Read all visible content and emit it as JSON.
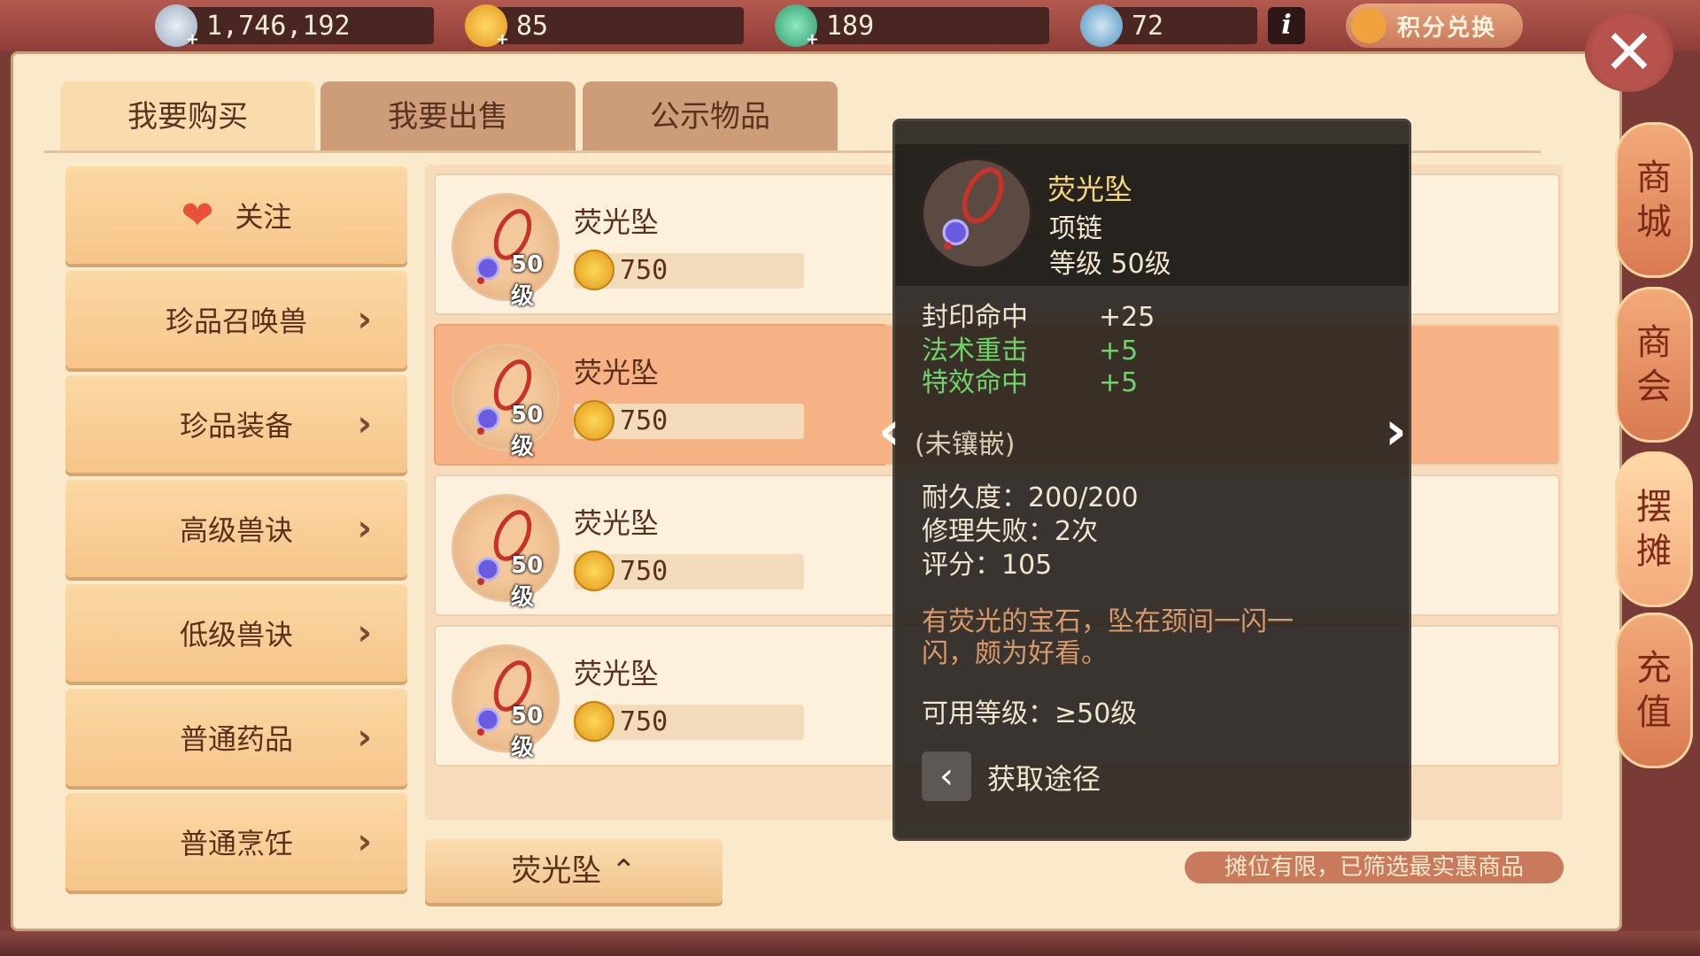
{
  "currencies": [
    {
      "name": "silver",
      "value": "1,746,192",
      "color": "#b7c7d9"
    },
    {
      "name": "dream-coin",
      "value": "85",
      "color": "#f0b53a"
    },
    {
      "name": "jade",
      "value": "189",
      "color": "#3fb98a"
    },
    {
      "name": "fortune",
      "value": "72",
      "color": "#5aa2c8"
    }
  ],
  "header": {
    "info": "i",
    "points_exchange": "积分兑换",
    "close": "✕"
  },
  "tabs": [
    {
      "label": "我要购买"
    },
    {
      "label": "我要出售"
    },
    {
      "label": "公示物品"
    }
  ],
  "categories": [
    {
      "label": "关注"
    },
    {
      "label": "珍品召唤兽"
    },
    {
      "label": "珍品装备"
    },
    {
      "label": "高级兽诀"
    },
    {
      "label": "低级兽诀"
    },
    {
      "label": "普通药品"
    },
    {
      "label": "普通烹饪"
    }
  ],
  "items": [
    {
      "name": "荧光坠",
      "level": "50级",
      "price": "750"
    },
    {
      "name": "荧光坠",
      "level": "50级",
      "price": "750"
    },
    {
      "name": "荧光坠",
      "level": "50级",
      "price": "750"
    },
    {
      "name": "荧光坠",
      "level": "50级",
      "price": "750"
    }
  ],
  "search_chip": "荧光坠",
  "notice": "摊位有限，已筛选最实惠商品",
  "side_nav": [
    {
      "label_top": "商",
      "label_bottom": "城"
    },
    {
      "label_top": "商",
      "label_bottom": "会"
    },
    {
      "label_top": "摆",
      "label_bottom": "摊"
    },
    {
      "label_top": "充",
      "label_bottom": "值"
    }
  ],
  "tooltip": {
    "name": "荧光坠",
    "type": "项链",
    "level": "等级 50级",
    "stats": [
      {
        "key": "封印命中",
        "val": "+25",
        "color": "#f1e6d0"
      },
      {
        "key": "法术重击",
        "val": "+5",
        "color": "#6fd36a"
      },
      {
        "key": "特效命中",
        "val": "+5",
        "color": "#6fd36a"
      }
    ],
    "socket": "(未镶嵌)",
    "durability": "耐久度：200/200",
    "repair_fail": "修理失败：2次",
    "score": "评分：105",
    "desc_line1": "有荧光的宝石，坠在颈间一闪一",
    "desc_line2": "闪，颇为好看。",
    "usable_level": "可用等级：≥50级",
    "route_label": "获取途径"
  }
}
